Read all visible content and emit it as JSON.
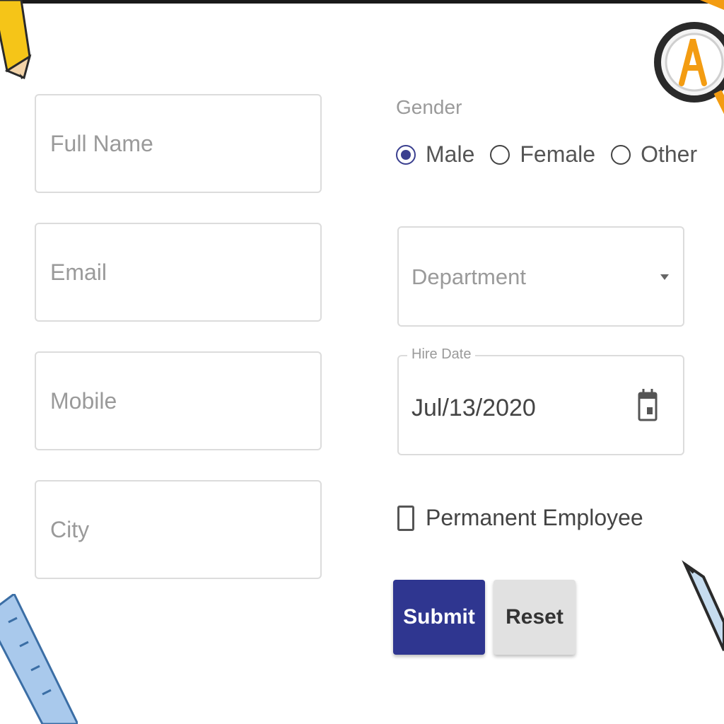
{
  "form": {
    "fields": {
      "full_name": {
        "placeholder": "Full Name",
        "value": ""
      },
      "email": {
        "placeholder": "Email",
        "value": ""
      },
      "mobile": {
        "placeholder": "Mobile",
        "value": ""
      },
      "city": {
        "placeholder": "City",
        "value": ""
      }
    },
    "gender": {
      "label": "Gender",
      "options": [
        {
          "label": "Male",
          "checked": true
        },
        {
          "label": "Female",
          "checked": false
        },
        {
          "label": "Other",
          "checked": false
        }
      ]
    },
    "department": {
      "placeholder": "Department"
    },
    "hire_date": {
      "label": "Hire Date",
      "value": "Jul/13/2020"
    },
    "permanent_employee": {
      "label": "Permanent Employee",
      "checked": false
    },
    "buttons": {
      "submit": "Submit",
      "reset": "Reset"
    }
  },
  "colors": {
    "primary": "#2f3690",
    "radio_accent": "#3a3f8f",
    "reset_bg": "#e1e1e1",
    "field_border": "#dcdcdc",
    "placeholder": "#9a9a9a"
  },
  "icons": [
    "pencil-icon",
    "magnifier-icon",
    "ruler-icon",
    "pen-icon",
    "calendar-icon",
    "dropdown-arrow-icon"
  ]
}
